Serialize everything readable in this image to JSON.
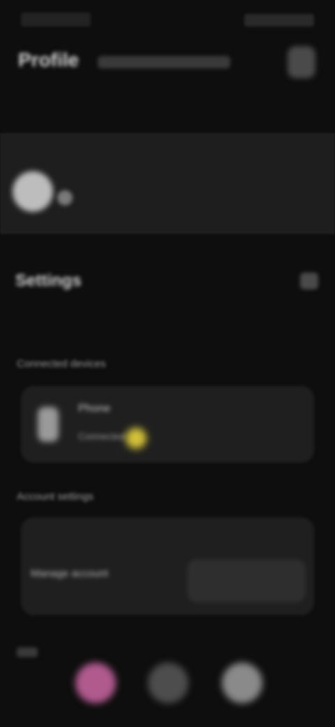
{
  "status": {},
  "header": {
    "title": "Profile"
  },
  "section": {
    "title": "Settings"
  },
  "groups": {
    "device_label": "Connected devices",
    "card1_line1": "Phone",
    "card1_line2": "Connected",
    "account_label": "Account settings",
    "card2_text": "Manage account"
  },
  "colors": {
    "background": "#0e0e0e",
    "accent_yellow": "#d4c23b",
    "accent_pink": "#b05a8e"
  },
  "icons": {
    "avatar": "avatar-icon",
    "card1": "phone-icon",
    "dock": [
      "pink-circle-icon",
      "gray-circle-icon",
      "light-circle-icon"
    ]
  }
}
